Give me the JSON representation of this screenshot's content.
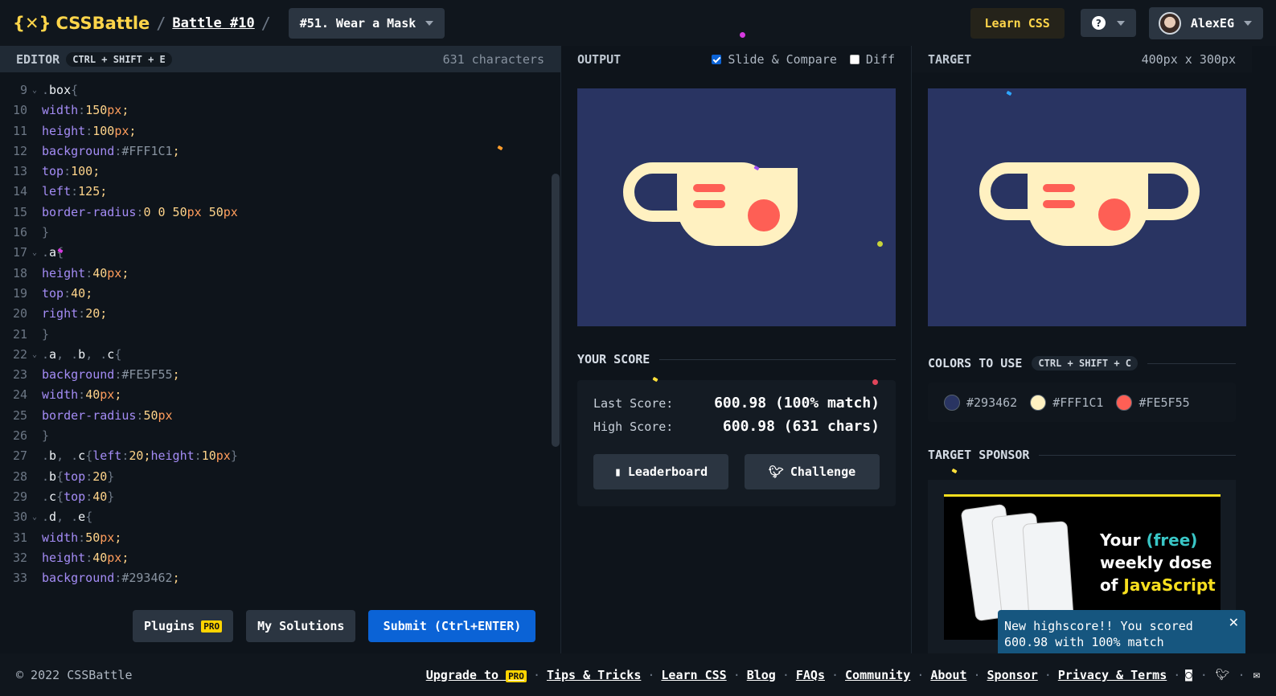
{
  "header": {
    "logo_text": "CSSBattle",
    "battle_label": "Battle #10",
    "challenge_title": "#51. Wear a Mask",
    "learn_css": "Learn CSS",
    "help_label": "?",
    "username": "AlexEG"
  },
  "editor": {
    "title": "EDITOR",
    "shortcut": "CTRL + SHIFT + E",
    "char_count": "631 characters",
    "lines": [
      {
        "n": "9",
        "fold": "v",
        "t": [
          [
            "pun",
            "."
          ],
          [
            "sel",
            "box"
          ],
          [
            "pun",
            "{"
          ]
        ]
      },
      {
        "n": "10",
        "t": [
          [
            "prop",
            "width"
          ],
          [
            "pun",
            ":"
          ],
          [
            "num",
            "150"
          ],
          [
            "unit",
            "px"
          ],
          [
            "num",
            ";"
          ]
        ]
      },
      {
        "n": "11",
        "t": [
          [
            "prop",
            "height"
          ],
          [
            "pun",
            ":"
          ],
          [
            "num",
            "100"
          ],
          [
            "unit",
            "px"
          ],
          [
            "num",
            ";"
          ]
        ]
      },
      {
        "n": "12",
        "t": [
          [
            "prop",
            "background"
          ],
          [
            "pun",
            ":"
          ],
          [
            "hex",
            "#FFF1C1"
          ],
          [
            "num",
            ";"
          ]
        ]
      },
      {
        "n": "13",
        "t": [
          [
            "prop",
            "top"
          ],
          [
            "pun",
            ":"
          ],
          [
            "num",
            "100"
          ],
          [
            "num",
            ";"
          ]
        ]
      },
      {
        "n": "14",
        "t": [
          [
            "prop",
            "left"
          ],
          [
            "pun",
            ":"
          ],
          [
            "num",
            "125"
          ],
          [
            "num",
            ";"
          ]
        ]
      },
      {
        "n": "15",
        "t": [
          [
            "prop",
            "border-radius"
          ],
          [
            "pun",
            ":"
          ],
          [
            "num",
            "0 0 50"
          ],
          [
            "unit",
            "px"
          ],
          [
            "num",
            " 50"
          ],
          [
            "unit",
            "px"
          ]
        ]
      },
      {
        "n": "16",
        "t": [
          [
            "pun",
            "}"
          ]
        ]
      },
      {
        "n": "17",
        "fold": "v",
        "t": [
          [
            "pun",
            "."
          ],
          [
            "sel",
            "a"
          ],
          [
            "pun",
            "{"
          ]
        ]
      },
      {
        "n": "18",
        "t": [
          [
            "prop",
            "height"
          ],
          [
            "pun",
            ":"
          ],
          [
            "num",
            "40"
          ],
          [
            "unit",
            "px"
          ],
          [
            "num",
            ";"
          ]
        ]
      },
      {
        "n": "19",
        "t": [
          [
            "prop",
            "top"
          ],
          [
            "pun",
            ":"
          ],
          [
            "num",
            "40"
          ],
          [
            "num",
            ";"
          ]
        ]
      },
      {
        "n": "20",
        "t": [
          [
            "prop",
            "right"
          ],
          [
            "pun",
            ":"
          ],
          [
            "num",
            "20"
          ],
          [
            "num",
            ";"
          ]
        ]
      },
      {
        "n": "21",
        "t": [
          [
            "pun",
            "}"
          ]
        ]
      },
      {
        "n": "22",
        "fold": "v",
        "t": [
          [
            "pun",
            "."
          ],
          [
            "sel",
            "a"
          ],
          [
            "pun",
            ", ."
          ],
          [
            "sel",
            "b"
          ],
          [
            "pun",
            ", ."
          ],
          [
            "sel",
            "c"
          ],
          [
            "pun",
            "{"
          ]
        ]
      },
      {
        "n": "23",
        "t": [
          [
            "prop",
            "background"
          ],
          [
            "pun",
            ":"
          ],
          [
            "hex",
            "#FE5F55"
          ],
          [
            "num",
            ";"
          ]
        ]
      },
      {
        "n": "24",
        "t": [
          [
            "prop",
            "width"
          ],
          [
            "pun",
            ":"
          ],
          [
            "num",
            "40"
          ],
          [
            "unit",
            "px"
          ],
          [
            "num",
            ";"
          ]
        ]
      },
      {
        "n": "25",
        "t": [
          [
            "prop",
            "border-radius"
          ],
          [
            "pun",
            ":"
          ],
          [
            "num",
            "50"
          ],
          [
            "unit",
            "px"
          ]
        ]
      },
      {
        "n": "26",
        "t": [
          [
            "pun",
            "}"
          ]
        ]
      },
      {
        "n": "27",
        "t": [
          [
            "pun",
            "."
          ],
          [
            "sel",
            "b"
          ],
          [
            "pun",
            ", ."
          ],
          [
            "sel",
            "c"
          ],
          [
            "pun",
            "{"
          ],
          [
            "prop",
            "left"
          ],
          [
            "pun",
            ":"
          ],
          [
            "num",
            "20"
          ],
          [
            "num",
            ";"
          ],
          [
            "prop",
            "height"
          ],
          [
            "pun",
            ":"
          ],
          [
            "num",
            "10"
          ],
          [
            "unit",
            "px"
          ],
          [
            "pun",
            "}"
          ]
        ]
      },
      {
        "n": "28",
        "t": [
          [
            "pun",
            "."
          ],
          [
            "sel",
            "b"
          ],
          [
            "pun",
            "{"
          ],
          [
            "prop",
            "top"
          ],
          [
            "pun",
            ":"
          ],
          [
            "num",
            "20"
          ],
          [
            "pun",
            "}"
          ]
        ]
      },
      {
        "n": "29",
        "t": [
          [
            "pun",
            "."
          ],
          [
            "sel",
            "c"
          ],
          [
            "pun",
            "{"
          ],
          [
            "prop",
            "top"
          ],
          [
            "pun",
            ":"
          ],
          [
            "num",
            "40"
          ],
          [
            "pun",
            "}"
          ]
        ]
      },
      {
        "n": "30",
        "fold": "v",
        "t": [
          [
            "pun",
            "."
          ],
          [
            "sel",
            "d"
          ],
          [
            "pun",
            ", ."
          ],
          [
            "sel",
            "e"
          ],
          [
            "pun",
            "{"
          ]
        ]
      },
      {
        "n": "31",
        "t": [
          [
            "prop",
            "width"
          ],
          [
            "pun",
            ":"
          ],
          [
            "num",
            "50"
          ],
          [
            "unit",
            "px"
          ],
          [
            "num",
            ";"
          ]
        ]
      },
      {
        "n": "32",
        "t": [
          [
            "prop",
            "height"
          ],
          [
            "pun",
            ":"
          ],
          [
            "num",
            "40"
          ],
          [
            "unit",
            "px"
          ],
          [
            "num",
            ";"
          ]
        ]
      },
      {
        "n": "33",
        "t": [
          [
            "prop",
            "background"
          ],
          [
            "pun",
            ":"
          ],
          [
            "hex",
            "#293462"
          ],
          [
            "num",
            ";"
          ]
        ]
      }
    ],
    "plugins": "Plugins",
    "pro": "PRO",
    "my_solutions": "My Solutions",
    "submit": "Submit (Ctrl+ENTER)"
  },
  "output": {
    "title": "OUTPUT",
    "slide_compare": "Slide & Compare",
    "diff": "Diff"
  },
  "target": {
    "title": "TARGET",
    "size": "400px x 300px"
  },
  "score": {
    "title": "YOUR SCORE",
    "last_label": "Last Score:",
    "last_value": "600.98 (100% match)",
    "high_label": "High Score:",
    "high_value": "600.98 (631 chars)",
    "leaderboard": "Leaderboard",
    "challenge": "Challenge"
  },
  "colors": {
    "title": "COLORS TO USE",
    "shortcut": "CTRL + SHIFT + C",
    "items": [
      {
        "hex": "#293462"
      },
      {
        "hex": "#FFF1C1"
      },
      {
        "hex": "#FE5F55"
      }
    ]
  },
  "sponsor": {
    "title": "TARGET SPONSOR",
    "ad_line1": "Your ",
    "ad_free": "(free)",
    "ad_line2": "weekly dose",
    "ad_line3": "of ",
    "ad_js": "JavaScript"
  },
  "toast": {
    "message": "New highscore!! You scored 600.98 with 100% match",
    "close": "✕"
  },
  "footer": {
    "copyright": "© 2022 CSSBattle",
    "upgrade": "Upgrade to",
    "pro": "PRO",
    "links": [
      "Tips & Tricks",
      "Learn CSS",
      "Blog",
      "FAQs",
      "Community",
      "About",
      "Sponsor",
      "Privacy & Terms"
    ]
  }
}
